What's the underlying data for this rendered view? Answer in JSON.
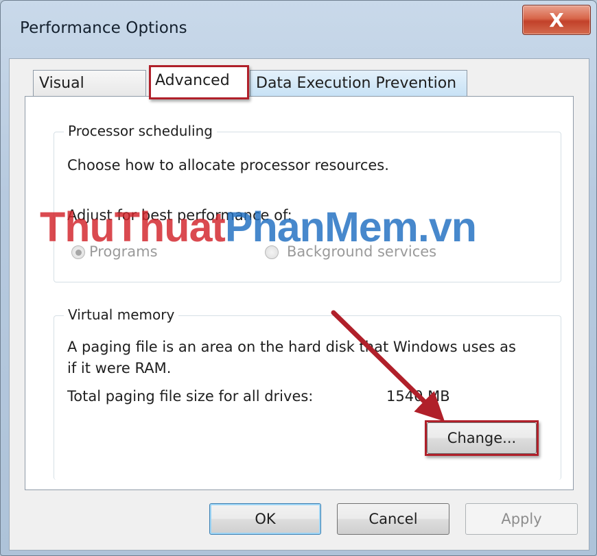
{
  "window": {
    "title": "Performance Options",
    "close_glyph": "X"
  },
  "tabs": [
    {
      "label": "Visual Effects",
      "selected": false
    },
    {
      "label": "Advanced",
      "selected": true
    },
    {
      "label": "Data Execution Prevention",
      "selected": false
    }
  ],
  "processor_scheduling": {
    "legend": "Processor scheduling",
    "description": "Choose how to allocate processor resources.",
    "adjust_label": "Adjust for best performance of:",
    "options": [
      {
        "label": "Programs",
        "selected": true
      },
      {
        "label": "Background services",
        "selected": false
      }
    ]
  },
  "virtual_memory": {
    "legend": "Virtual memory",
    "description_line1": "A paging file is an area on the hard disk that Windows uses as",
    "description_line2": "if it were RAM.",
    "total_label": "Total paging file size for all drives:",
    "total_value": "1540 MB",
    "change_button": "Change..."
  },
  "footer": {
    "ok": "OK",
    "cancel": "Cancel",
    "apply": "Apply"
  },
  "watermark": {
    "part1": "ThuThuat",
    "part2": "PhanMem.vn"
  },
  "colors": {
    "highlight": "#b0202a",
    "arrow": "#b0202a",
    "watermark_red": "#d2232a",
    "watermark_blue": "#1f6fc1"
  }
}
